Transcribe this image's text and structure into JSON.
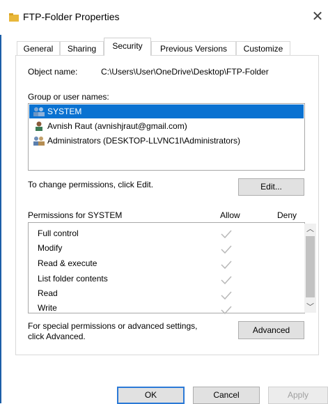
{
  "window": {
    "title": "FTP-Folder Properties",
    "close_glyph": "✕"
  },
  "tabs": [
    {
      "label": "General",
      "active": false
    },
    {
      "label": "Sharing",
      "active": false
    },
    {
      "label": "Security",
      "active": true
    },
    {
      "label": "Previous Versions",
      "active": false
    },
    {
      "label": "Customize",
      "active": false
    }
  ],
  "security": {
    "object_name_label": "Object name:",
    "object_name_value": "C:\\Users\\User\\OneDrive\\Desktop\\FTP-Folder",
    "group_label": "Group or user names:",
    "users": [
      {
        "name": "SYSTEM",
        "icon": "group-users-icon",
        "selected": true
      },
      {
        "name": "Avnish Raut (avnishjraut@gmail.com)",
        "icon": "user-icon",
        "selected": false
      },
      {
        "name": "Administrators (DESKTOP-LLVNC1I\\Administrators)",
        "icon": "group-users-icon",
        "selected": false
      }
    ],
    "change_hint": "To change permissions, click Edit.",
    "edit_button": "Edit...",
    "permissions_label": "Permissions for SYSTEM",
    "allow_header": "Allow",
    "deny_header": "Deny",
    "permissions": [
      {
        "name": "Full control",
        "allow": true,
        "deny": false
      },
      {
        "name": "Modify",
        "allow": true,
        "deny": false
      },
      {
        "name": "Read & execute",
        "allow": true,
        "deny": false
      },
      {
        "name": "List folder contents",
        "allow": true,
        "deny": false
      },
      {
        "name": "Read",
        "allow": true,
        "deny": false
      },
      {
        "name": "Write",
        "allow": true,
        "deny": false
      }
    ],
    "special_hint_line1": "For special permissions or advanced settings,",
    "special_hint_line2": "click Advanced.",
    "advanced_button": "Advanced"
  },
  "footer": {
    "ok": "OK",
    "cancel": "Cancel",
    "apply": "Apply"
  },
  "colors": {
    "selection": "#0a72d1",
    "accent": "#2b79d6",
    "check": "#b8b8b8"
  }
}
